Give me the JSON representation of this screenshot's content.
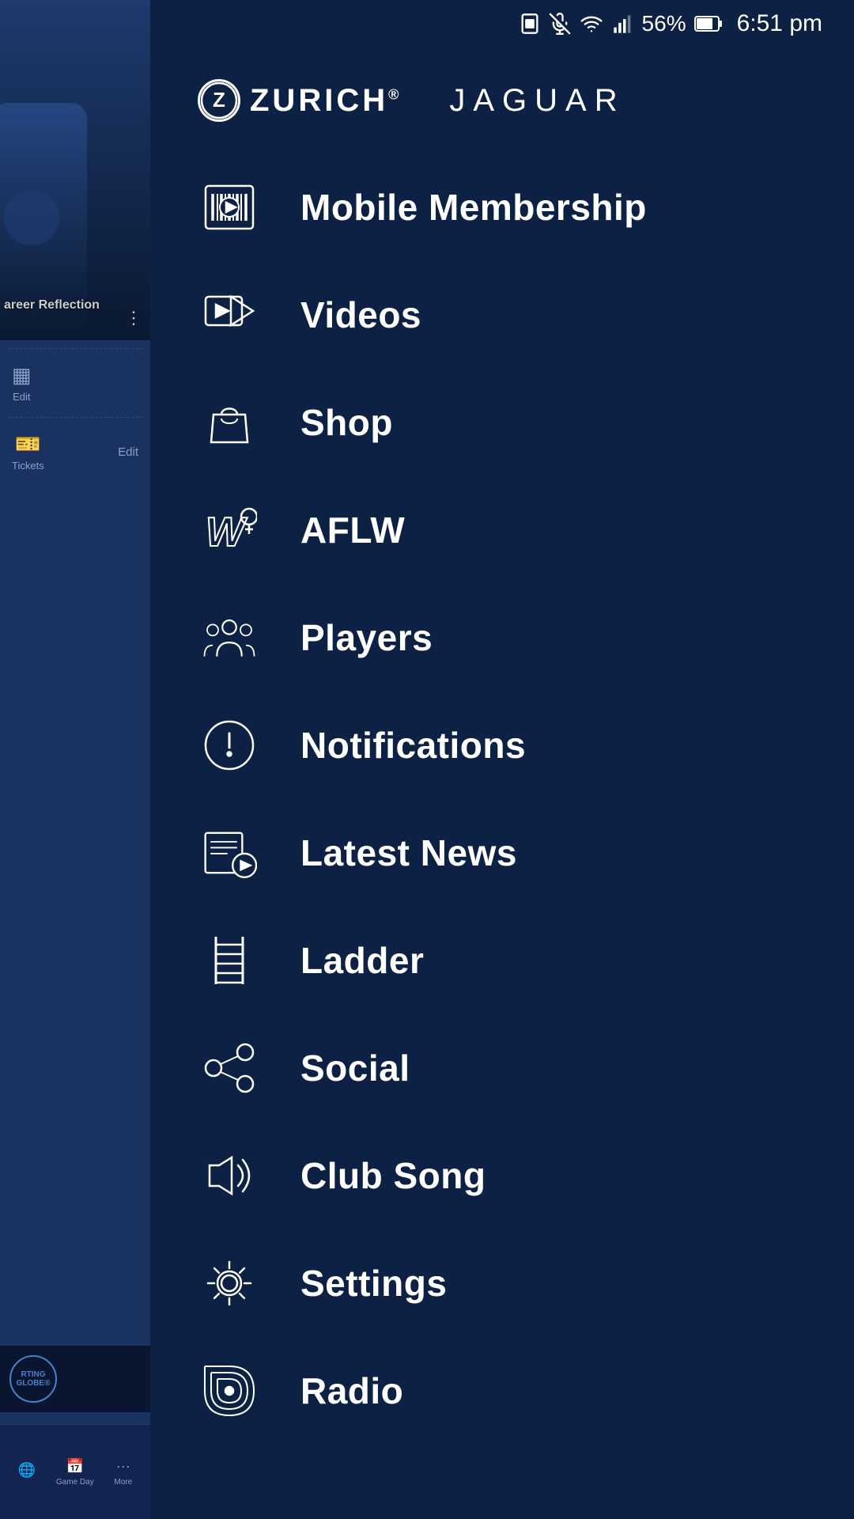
{
  "statusBar": {
    "battery": "56%",
    "time": "6:51 pm"
  },
  "sponsors": {
    "zurich": "ZURICH",
    "zurichSymbol": "Z",
    "jaguar": "JAGUAR"
  },
  "menu": {
    "items": [
      {
        "id": "mobile-membership",
        "label": "Mobile Membership",
        "icon": "barcode-icon"
      },
      {
        "id": "videos",
        "label": "Videos",
        "icon": "videos-icon"
      },
      {
        "id": "shop",
        "label": "Shop",
        "icon": "shop-icon"
      },
      {
        "id": "aflw",
        "label": "AFLW",
        "icon": "aflw-icon"
      },
      {
        "id": "players",
        "label": "Players",
        "icon": "players-icon"
      },
      {
        "id": "notifications",
        "label": "Notifications",
        "icon": "notifications-icon"
      },
      {
        "id": "latest-news",
        "label": "Latest News",
        "icon": "latest-news-icon"
      },
      {
        "id": "ladder",
        "label": "Ladder",
        "icon": "ladder-icon"
      },
      {
        "id": "social",
        "label": "Social",
        "icon": "social-icon"
      },
      {
        "id": "club-song",
        "label": "Club Song",
        "icon": "club-song-icon"
      },
      {
        "id": "settings",
        "label": "Settings",
        "icon": "settings-icon"
      },
      {
        "id": "radio",
        "label": "Radio",
        "icon": "radio-icon"
      }
    ]
  },
  "bgApp": {
    "careerText": "areer Reflection",
    "globeText": "RTING GLOBE®",
    "editLabel": "Edit",
    "ticketsLabel": "Tickets",
    "gameDayLabel": "Game Day",
    "moreLabel": "More"
  }
}
